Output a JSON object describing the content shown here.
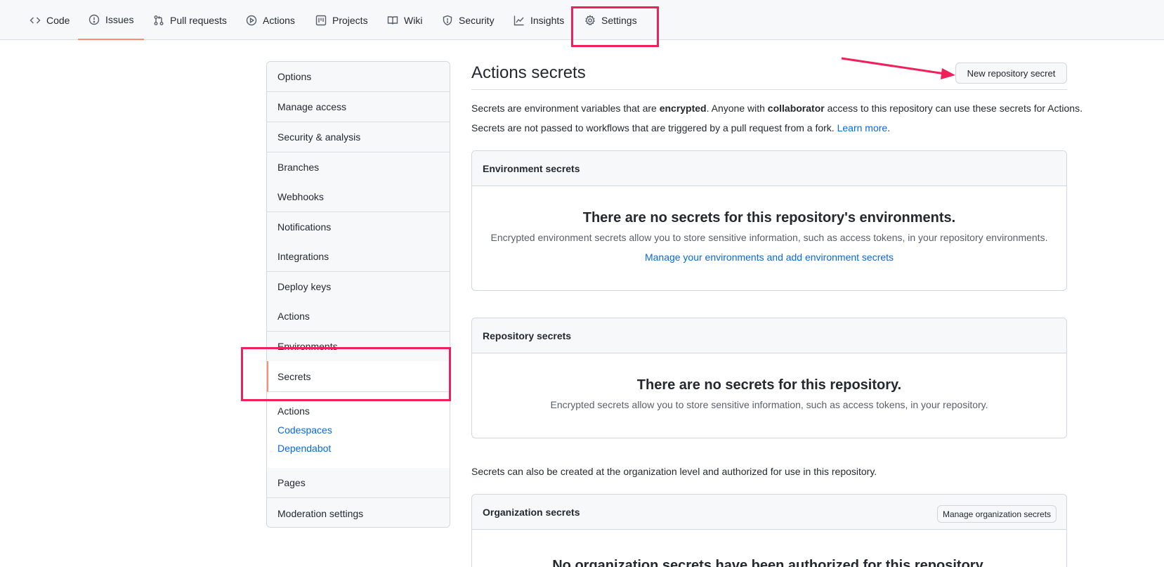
{
  "nav": {
    "tabs": [
      {
        "label": "Code",
        "icon": "code-icon"
      },
      {
        "label": "Issues",
        "icon": "issue-icon"
      },
      {
        "label": "Pull requests",
        "icon": "pull-request-icon"
      },
      {
        "label": "Actions",
        "icon": "play-icon"
      },
      {
        "label": "Projects",
        "icon": "project-icon"
      },
      {
        "label": "Wiki",
        "icon": "book-icon"
      },
      {
        "label": "Security",
        "icon": "shield-icon"
      },
      {
        "label": "Insights",
        "icon": "graph-icon"
      },
      {
        "label": "Settings",
        "icon": "gear-icon"
      }
    ]
  },
  "sidebar": {
    "items": [
      "Options",
      "Manage access",
      "Security & analysis",
      "Branches",
      "Webhooks",
      "Notifications",
      "Integrations",
      "Deploy keys",
      "Actions",
      "Environments",
      "Secrets"
    ],
    "sub_items": [
      "Actions",
      "Codespaces",
      "Dependabot"
    ],
    "bottom_items": [
      "Pages",
      "Moderation settings"
    ]
  },
  "main": {
    "title": "Actions secrets",
    "new_secret_button": "New repository secret",
    "intro": {
      "part1": "Secrets are environment variables that are ",
      "bold1": "encrypted",
      "part2": ". Anyone with ",
      "bold2": "collaborator",
      "part3": " access to this repository can use these secrets for Actions."
    },
    "fork_note": "Secrets are not passed to workflows that are triggered by a pull request from a fork. ",
    "learn_more": "Learn more",
    "period": ".",
    "env_box": {
      "header": "Environment secrets",
      "title": "There are no secrets for this repository's environments.",
      "desc": "Encrypted environment secrets allow you to store sensitive information, such as access tokens, in your repository environments.",
      "link": "Manage your environments and add environment secrets"
    },
    "repo_box": {
      "header": "Repository secrets",
      "title": "There are no secrets for this repository.",
      "desc": "Encrypted secrets allow you to store sensitive information, such as access tokens, in your repository."
    },
    "org_note": "Secrets can also be created at the organization level and authorized for use in this repository.",
    "org_box": {
      "header": "Organization secrets",
      "button": "Manage organization secrets",
      "title": "No organization secrets have been authorized for this repository."
    }
  },
  "colors": {
    "annotation": "#f0215a",
    "link": "#0969da",
    "selected_accent": "#fd8c73"
  }
}
